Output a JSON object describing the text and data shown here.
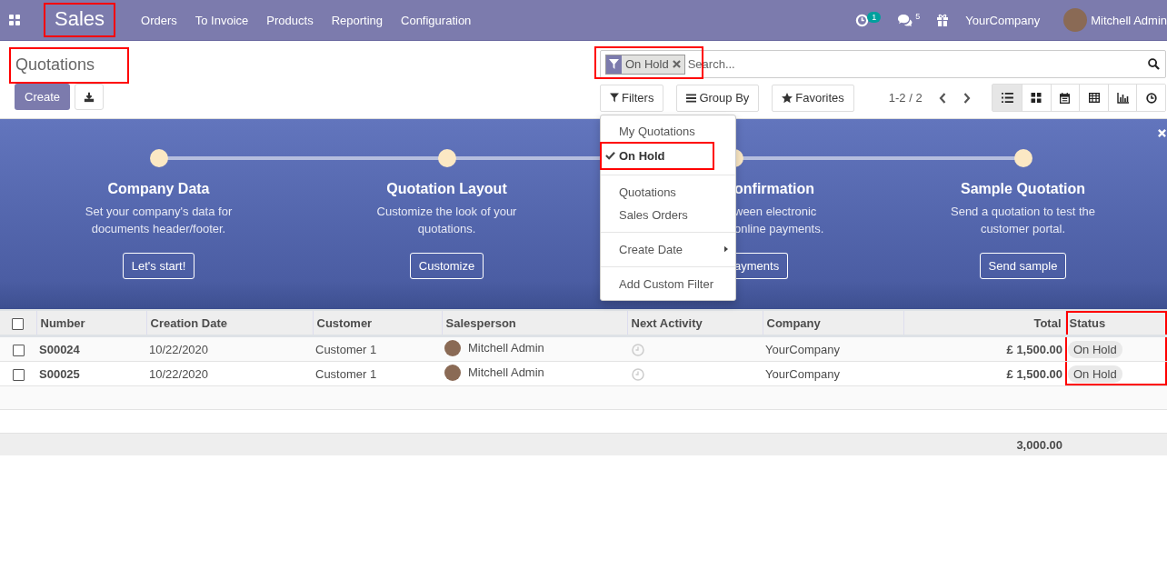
{
  "navbar": {
    "app_name": "Sales",
    "app_name_highlighted": true,
    "menu": [
      "Orders",
      "To Invoice",
      "Products",
      "Reporting",
      "Configuration"
    ],
    "activity_badge": "1",
    "messages_count": "5",
    "company": "YourCompany",
    "user": "Mitchell Admin"
  },
  "breadcrumb": {
    "title": "Quotations",
    "highlighted": true
  },
  "create_button": "Create",
  "search": {
    "facet": "On Hold",
    "placeholder": "Search...",
    "highlighted": true
  },
  "search_buttons": [
    {
      "label": "Filters",
      "kind": "filter"
    },
    {
      "label": "Group By",
      "kind": "group"
    },
    {
      "label": "Favorites",
      "kind": "star"
    }
  ],
  "pager": "1-2 / 2",
  "views": [
    {
      "kind": "list",
      "selected": true
    },
    {
      "kind": "kanban",
      "selected": false
    },
    {
      "kind": "calendar",
      "selected": false
    },
    {
      "kind": "pivot",
      "selected": false
    },
    {
      "kind": "graph",
      "selected": false
    },
    {
      "kind": "activity",
      "selected": false
    }
  ],
  "filter_menu": {
    "groups": [
      [
        {
          "label": "My Quotations",
          "kind": "option",
          "checked": false,
          "highlighted": false
        },
        {
          "label": "On Hold",
          "kind": "option",
          "checked": true,
          "highlighted": true
        }
      ],
      [
        {
          "label": "Quotations",
          "kind": "option",
          "checked": false,
          "highlighted": false
        },
        {
          "label": "Sales Orders",
          "kind": "option",
          "checked": false,
          "highlighted": false
        }
      ],
      [
        {
          "label": "Create Date",
          "kind": "submenu",
          "checked": false,
          "highlighted": false
        }
      ],
      [
        {
          "label": "Add Custom Filter",
          "kind": "option",
          "checked": false,
          "highlighted": false
        }
      ]
    ]
  },
  "banner": {
    "steps": [
      {
        "title": "Company Data",
        "lines": [
          "Set your company's data for",
          "documents header/footer."
        ],
        "button": "Let's start!",
        "partly_covered": false
      },
      {
        "title": "Quotation Layout",
        "lines": [
          "Customize the look of your",
          "quotations."
        ],
        "button": "Customize",
        "partly_covered": false
      },
      {
        "title": "onfirmation",
        "lines": [
          "ween electronic",
          "online payments."
        ],
        "button": "ayments",
        "partly_covered": true
      },
      {
        "title": "Sample Quotation",
        "lines": [
          "Send a quotation to test the",
          "customer portal."
        ],
        "button": "Send sample",
        "partly_covered": false
      }
    ]
  },
  "table": {
    "all_checked": false,
    "columns": [
      {
        "label": "Number",
        "highlighted": false
      },
      {
        "label": "Creation Date",
        "highlighted": false
      },
      {
        "label": "Customer",
        "highlighted": false
      },
      {
        "label": "Salesperson",
        "highlighted": false
      },
      {
        "label": "Next Activity",
        "highlighted": false
      },
      {
        "label": "Company",
        "highlighted": false
      },
      {
        "label": "Total",
        "highlighted": false
      },
      {
        "label": "Status",
        "highlighted": true
      }
    ],
    "rows": [
      {
        "checked": false,
        "number": "S00024",
        "date": "10/22/2020",
        "customer": "Customer 1",
        "salesperson": "Mitchell Admin",
        "company": "YourCompany",
        "total": "£ 1,500.00",
        "status": "On Hold"
      },
      {
        "checked": false,
        "number": "S00025",
        "date": "10/22/2020",
        "customer": "Customer 1",
        "salesperson": "Mitchell Admin",
        "company": "YourCompany",
        "total": "£ 1,500.00",
        "status": "On Hold"
      }
    ],
    "footer_total": "3,000.00"
  }
}
